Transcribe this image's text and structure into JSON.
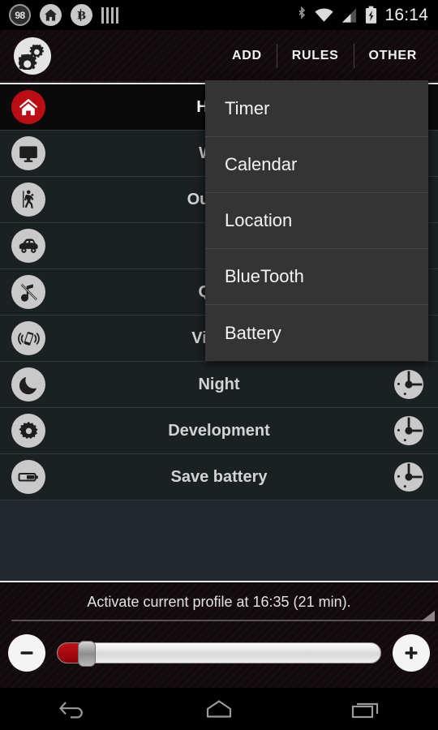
{
  "statusbar": {
    "badge_count": "98",
    "icons": [
      "counter-badge-icon",
      "home-circle-icon",
      "bitcoin-icon",
      "bars-icon",
      "bluetooth-icon",
      "wifi-icon",
      "cell-signal-icon",
      "battery-charging-icon"
    ],
    "time": "16:14"
  },
  "actionbar": {
    "app_icon": "gears-icon",
    "buttons": [
      {
        "label": "ADD",
        "name": "add"
      },
      {
        "label": "RULES",
        "name": "rules"
      },
      {
        "label": "OTHER",
        "name": "other"
      }
    ]
  },
  "menu": {
    "open": true,
    "items": [
      {
        "label": "Timer"
      },
      {
        "label": "Calendar"
      },
      {
        "label": "Location"
      },
      {
        "label": "BlueTooth"
      },
      {
        "label": "Battery"
      }
    ]
  },
  "profiles": [
    {
      "label": "Home",
      "icon": "home-icon",
      "icon_color": "#bc0d14",
      "active": true,
      "has_dial": false
    },
    {
      "label": "Work",
      "icon": "monitor-icon",
      "icon_color": "#c9c9c9",
      "active": false,
      "has_dial": false
    },
    {
      "label": "Outdoor",
      "icon": "hiker-icon",
      "icon_color": "#c9c9c9",
      "active": false,
      "has_dial": false
    },
    {
      "label": "Car",
      "icon": "car-icon",
      "icon_color": "#c9c9c9",
      "active": false,
      "has_dial": false
    },
    {
      "label": "Quiet",
      "icon": "mute-icon",
      "icon_color": "#c9c9c9",
      "active": false,
      "has_dial": false
    },
    {
      "label": "Vibrate",
      "icon": "vibrate-icon",
      "icon_color": "#c9c9c9",
      "active": false,
      "has_dial": false
    },
    {
      "label": "Night",
      "icon": "moon-icon",
      "icon_color": "#c9c9c9",
      "active": false,
      "has_dial": true
    },
    {
      "label": "Development",
      "icon": "gear-icon",
      "icon_color": "#c9c9c9",
      "active": false,
      "has_dial": true
    },
    {
      "label": "Save battery",
      "icon": "battery-icon",
      "icon_color": "#c9c9c9",
      "active": false,
      "has_dial": true
    }
  ],
  "bottom": {
    "schedule_text": "Activate current profile at 16:35 (21 min).",
    "decrease_label": "−",
    "increase_label": "+",
    "slider_percent": 9
  },
  "navbar": {
    "buttons": [
      "back-icon",
      "home-icon",
      "recents-icon"
    ]
  },
  "colors": {
    "accent_red": "#bc0d14",
    "list_bg": "#22282b",
    "row_bg": "#1b2023",
    "menu_bg": "#343434"
  }
}
